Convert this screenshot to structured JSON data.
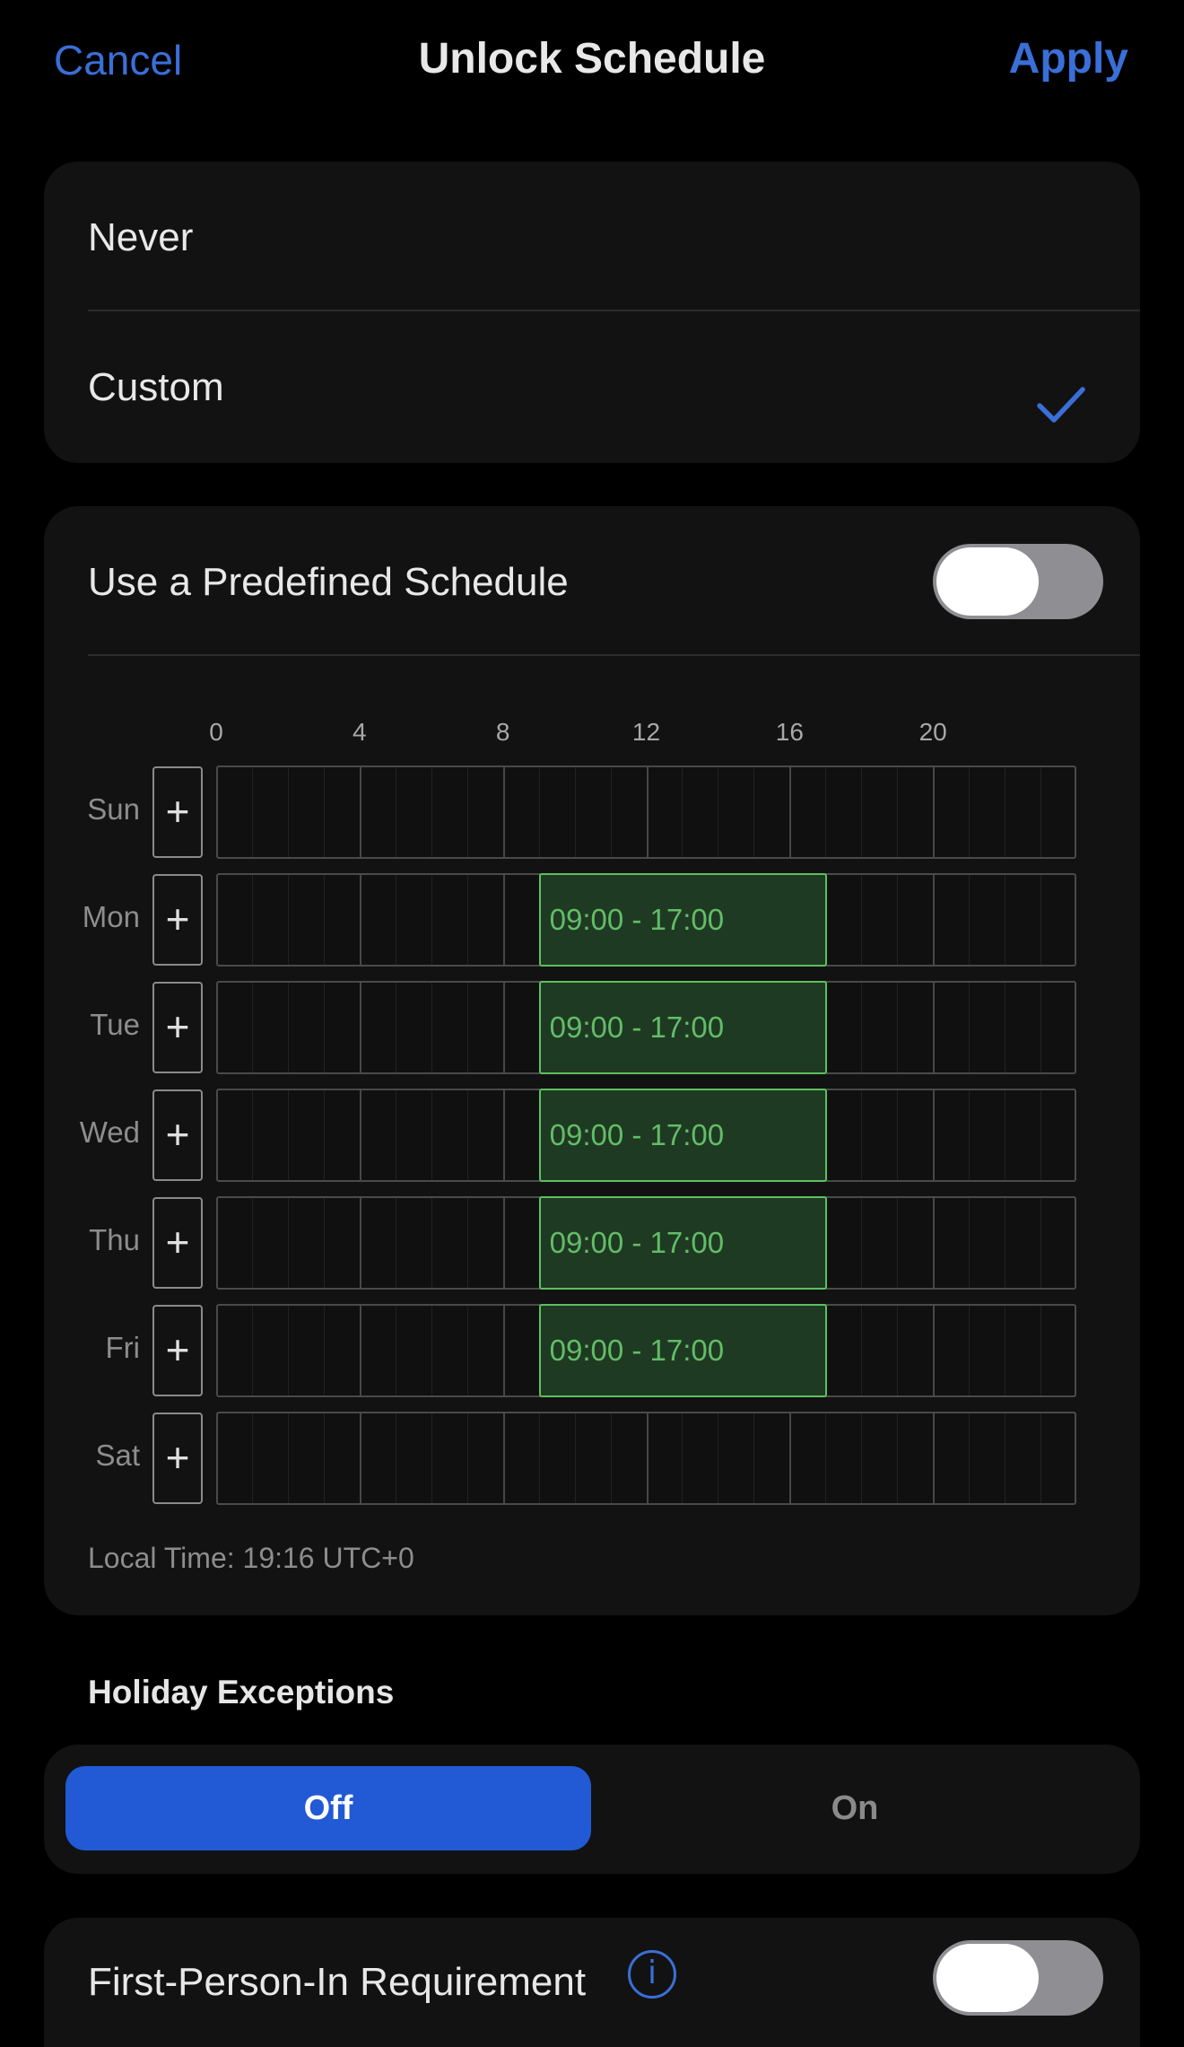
{
  "header": {
    "cancel_label": "Cancel",
    "title": "Unlock Schedule",
    "apply_label": "Apply"
  },
  "mode_options": [
    {
      "label": "Never",
      "selected": false
    },
    {
      "label": "Custom",
      "selected": true
    }
  ],
  "predefined": {
    "label": "Use a Predefined Schedule",
    "enabled": false
  },
  "schedule": {
    "hour_labels": [
      "0",
      "4",
      "8",
      "12",
      "16",
      "20"
    ],
    "days": [
      {
        "label": "Sun",
        "add_label": "+",
        "block": null
      },
      {
        "label": "Mon",
        "add_label": "+",
        "block": "09:00 - 17:00"
      },
      {
        "label": "Tue",
        "add_label": "+",
        "block": "09:00 - 17:00"
      },
      {
        "label": "Wed",
        "add_label": "+",
        "block": "09:00 - 17:00"
      },
      {
        "label": "Thu",
        "add_label": "+",
        "block": "09:00 - 17:00"
      },
      {
        "label": "Fri",
        "add_label": "+",
        "block": "09:00 - 17:00"
      },
      {
        "label": "Sat",
        "add_label": "+",
        "block": null
      }
    ],
    "block_start_hour": 9,
    "block_end_hour": 17,
    "local_time": "Local Time: 19:16 UTC+0"
  },
  "holiday": {
    "title": "Holiday Exceptions",
    "off_label": "Off",
    "on_label": "On",
    "selected": "Off"
  },
  "first_person": {
    "label": "First-Person-In Requirement",
    "info_icon": "info-icon",
    "info_glyph": "i",
    "enabled": false
  },
  "colors": {
    "accent": "#3a6fd8",
    "segment_selected": "#2259d4",
    "block_fill": "#1f3a22",
    "block_border": "#5cc05e"
  }
}
